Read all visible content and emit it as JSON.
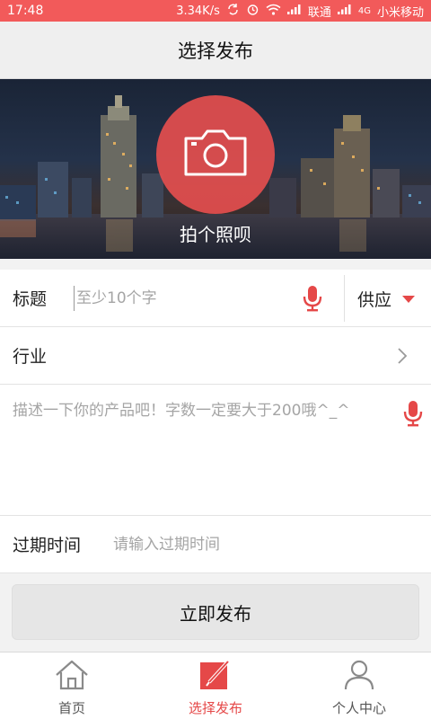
{
  "status_bar": {
    "time": "17:48",
    "speed": "3.34K/s",
    "carrier1": "联通",
    "network_type": "4G",
    "carrier2": "小米移动",
    "icons": [
      "sync-icon",
      "alarm-icon",
      "wifi-icon",
      "signal-icon",
      "signal-icon"
    ]
  },
  "header": {
    "title": "选择发布"
  },
  "hero": {
    "caption": "拍个照呗",
    "icon": "camera-icon"
  },
  "form": {
    "title_label": "标题",
    "title_placeholder": "至少10个字",
    "type_value": "供应",
    "industry_label": "行业",
    "description_placeholder": "描述一下你的产品吧！字数一定要大于200哦^_^",
    "expire_label": "过期时间",
    "expire_placeholder": "请输入过期时间"
  },
  "publish_button": {
    "label": "立即发布"
  },
  "tabs": [
    {
      "label": "首页",
      "icon": "home-icon",
      "active": false
    },
    {
      "label": "选择发布",
      "icon": "edit-icon",
      "active": true
    },
    {
      "label": "个人中心",
      "icon": "user-icon",
      "active": false
    }
  ],
  "colors": {
    "accent": "#e54848",
    "status_bar": "#f25a5a",
    "background": "#f2f2f2"
  }
}
